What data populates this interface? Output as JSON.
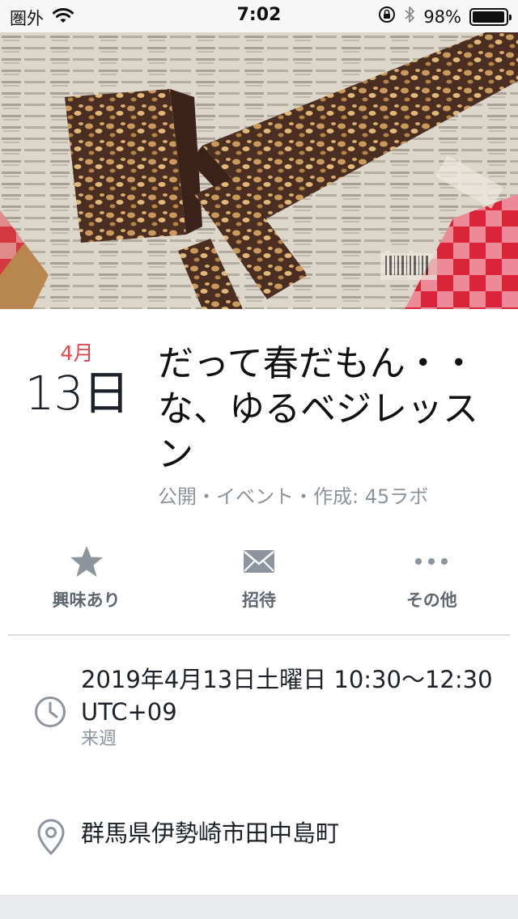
{
  "status_bar": {
    "carrier": "圏外",
    "time": "7:02",
    "battery": "98%",
    "battery_level": 0.98,
    "icons": [
      "wifi-icon",
      "rotation-lock-icon",
      "bluetooth-icon",
      "battery-icon"
    ]
  },
  "event": {
    "month": "4月",
    "day": "13日",
    "title": "だって春だもん・・な、ゆるベジレッスン",
    "meta": "公開・イベント・作成: 45ラボ"
  },
  "actions": [
    {
      "label": "興味あり",
      "icon": "star-icon"
    },
    {
      "label": "招待",
      "icon": "envelope-icon"
    },
    {
      "label": "その他",
      "icon": "more-icon"
    }
  ],
  "details": {
    "datetime": "2019年4月13日土曜日 10:30〜12:30 UTC+09",
    "relative": "来週",
    "location": "群馬県伊勢崎市田中島町"
  },
  "colors": {
    "accent_date": "#e0474b",
    "icon_gray": "#8d949e",
    "text_secondary": "#606770"
  }
}
